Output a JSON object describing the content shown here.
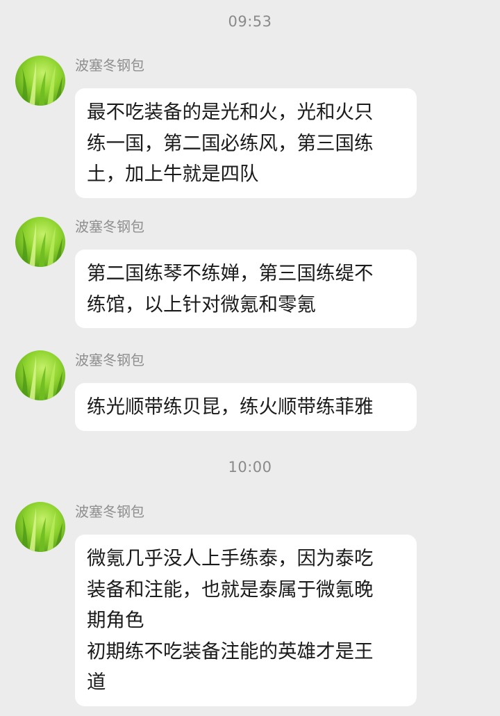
{
  "timestamps": [
    "09:53",
    "10:00"
  ],
  "messages": [
    {
      "sender": "波塞冬钢包",
      "text": "最不吃装备的是光和火，光和火只\n练一国，第二国必练风，第三国练\n土，加上牛就是四队"
    },
    {
      "sender": "波塞冬钢包",
      "text": "第二国练琴不练婵，第三国练缇不\n练馆，以上针对微氪和零氪"
    },
    {
      "sender": "波塞冬钢包",
      "text": "练光顺带练贝昆，练火顺带练菲雅"
    },
    {
      "sender": "波塞冬钢包",
      "text": "微氪几乎没人上手练泰，因为泰吃\n装备和注能，也就是泰属于微氪晚\n期角色\n初期练不吃装备注能的英雄才是王\n道"
    }
  ],
  "colors": {
    "background": "#ececec",
    "bubble": "#ffffff",
    "sender_name": "#8e8e8e",
    "timestamp": "#8a8a8a"
  },
  "icons": {
    "avatar": "green-grass-avatar"
  }
}
